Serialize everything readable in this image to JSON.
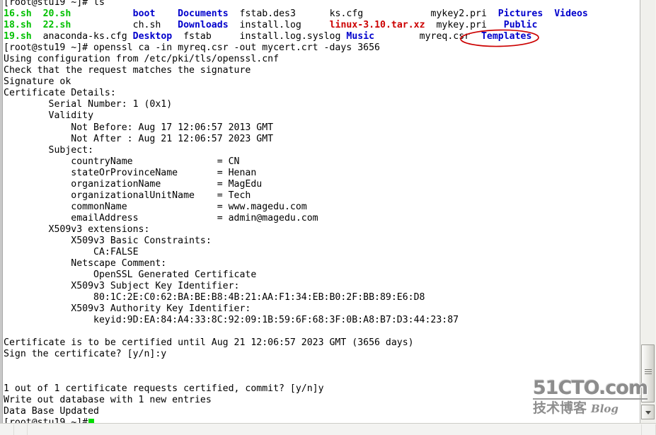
{
  "terminal": {
    "prompt": "[root@stu19 ~]#",
    "first_command": "ls",
    "ca_command": "openssl ca -in myreq.csr -out mycert.crt -days 3656",
    "ls_listing": {
      "columns": 7,
      "rows": [
        [
          {
            "name": "16.sh",
            "type": "exec"
          },
          {
            "name": "20.sh",
            "type": "exec"
          },
          {
            "name": "boot",
            "type": "dir"
          },
          {
            "name": "Documents",
            "type": "dir"
          },
          {
            "name": "fstab.des3",
            "type": "file"
          },
          {
            "name": "ks.cfg",
            "type": "file"
          },
          {
            "name": "mykey2.pri",
            "type": "file"
          },
          {
            "name": "Pictures",
            "type": "dir"
          },
          {
            "name": "Videos",
            "type": "dir"
          }
        ],
        [
          {
            "name": "18.sh",
            "type": "exec"
          },
          {
            "name": "22.sh",
            "type": "exec"
          },
          {
            "name": "ch.sh",
            "type": "file"
          },
          {
            "name": "Downloads",
            "type": "dir"
          },
          {
            "name": "install.log",
            "type": "file"
          },
          {
            "name": "linux-3.10.tar.xz",
            "type": "archive"
          },
          {
            "name": "mykey.pri",
            "type": "file"
          },
          {
            "name": "Public",
            "type": "dir"
          }
        ],
        [
          {
            "name": "19.sh",
            "type": "exec"
          },
          {
            "name": "anaconda-ks.cfg",
            "type": "file"
          },
          {
            "name": "Desktop",
            "type": "dir"
          },
          {
            "name": "fstab",
            "type": "file"
          },
          {
            "name": "install.log.syslog",
            "type": "file"
          },
          {
            "name": "Music",
            "type": "dir"
          },
          {
            "name": "myreq.csr",
            "type": "file",
            "annotated": true
          },
          {
            "name": "Templates",
            "type": "dir"
          }
        ]
      ]
    },
    "lines": {
      "l01": "[root@stu19 ~]# ls",
      "l_ls_row1_c1": "16.sh",
      "l_ls_row1_c2": "20.sh",
      "l_ls_row1_c3": "boot",
      "l_ls_row1_c4": "Documents",
      "l_ls_row1_c5": "fstab.des3",
      "l_ls_row1_c6": "ks.cfg",
      "l_ls_row1_c7": "mykey2.pri",
      "l_ls_row1_c8": "Pictures",
      "l_ls_row1_c9": "Videos",
      "l_ls_row2_c1": "18.sh",
      "l_ls_row2_c2": "22.sh",
      "l_ls_row2_c3": "ch.sh",
      "l_ls_row2_c4": "Downloads",
      "l_ls_row2_c5": "install.log",
      "l_ls_row2_c6": "linux-3.10.tar.xz",
      "l_ls_row2_c7": "mykey.pri",
      "l_ls_row2_c8": "Public",
      "l_ls_row3_c1": "19.sh",
      "l_ls_row3_c2": "anaconda-ks.cfg",
      "l_ls_row3_c3": "Desktop",
      "l_ls_row3_c4": "fstab",
      "l_ls_row3_c5": "install.log.syslog",
      "l_ls_row3_c6": "Music",
      "l_ls_row3_c7": "myreq.csr",
      "l_ls_row3_c8": "Templates",
      "l_cmd": "[root@stu19 ~]# openssl ca -in myreq.csr -out mycert.crt -days 3656",
      "l_using": "Using configuration from /etc/pki/tls/openssl.cnf",
      "l_check": "Check that the request matches the signature",
      "l_sigok": "Signature ok",
      "l_certdetails": "Certificate Details:",
      "l_serial": "        Serial Number: 1 (0x1)",
      "l_validity": "        Validity",
      "l_notbefore": "            Not Before: Aug 17 12:06:57 2013 GMT",
      "l_notafter": "            Not After : Aug 21 12:06:57 2023 GMT",
      "l_subject": "        Subject:",
      "l_country": "            countryName               = CN",
      "l_state": "            stateOrProvinceName       = Henan",
      "l_org": "            organizationName          = MagEdu",
      "l_orgunit": "            organizationalUnitName    = Tech",
      "l_common": "            commonName                = www.magedu.com",
      "l_email": "            emailAddress              = admin@magedu.com",
      "l_x509ext": "        X509v3 extensions:",
      "l_basic": "            X509v3 Basic Constraints:",
      "l_cafalse": "                CA:FALSE",
      "l_netscape": "            Netscape Comment:",
      "l_opensslgen": "                OpenSSL Generated Certificate",
      "l_subjkeyid": "            X509v3 Subject Key Identifier:",
      "l_subjkeyval": "                80:1C:2E:C0:62:BA:BE:B8:4B:21:AA:F1:34:EB:B0:2F:BB:89:E6:D8",
      "l_authkeyid": "            X509v3 Authority Key Identifier:",
      "l_authkeyval": "                keyid:9D:EA:84:A4:33:8C:92:09:1B:59:6F:68:3F:0B:A8:B7:D3:44:23:87",
      "l_blank1": "",
      "l_certuntil": "Certificate is to be certified until Aug 21 12:06:57 2023 GMT (3656 days)",
      "l_signcert": "Sign the certificate? [y/n]:y",
      "l_blank2": "",
      "l_blank3": "",
      "l_commit": "1 out of 1 certificate requests certified, commit? [y/n]y",
      "l_writeout": "Write out database with 1 new entries",
      "l_dbupdated": "Data Base Updated",
      "l_finalprompt": "[root@stu19 ~]#"
    }
  },
  "annotation": {
    "shape": "ellipse",
    "target": "myreq.csr",
    "color": "#cc0000"
  },
  "scrollbar": {
    "orientation": "vertical",
    "position": "near-bottom",
    "down_arrow": "▼"
  },
  "watermark": {
    "site": "51CTO.com",
    "chinese": "技术博客",
    "blog": "Blog"
  },
  "colors": {
    "exec": "#00c000",
    "dir": "#0000cc",
    "archive": "#cc0000",
    "file": "#000000",
    "background": "#ffffff",
    "cursor": "#00dd00"
  }
}
